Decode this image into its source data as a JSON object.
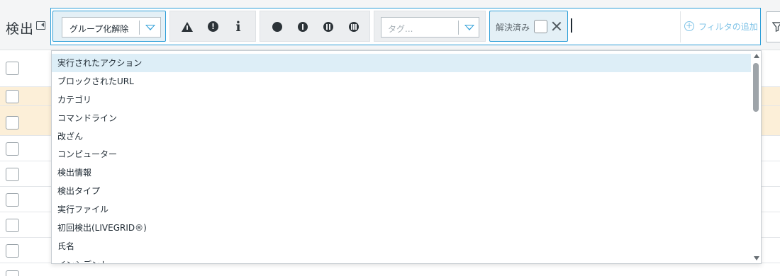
{
  "header": {
    "title": "検出"
  },
  "filters": {
    "group_select_value": "グループ化解除",
    "severity": [
      {
        "name": "warning",
        "icon": "warning-triangle-icon"
      },
      {
        "name": "error",
        "icon": "exclamation-circle-icon",
        "glyph": "!"
      },
      {
        "name": "info",
        "icon": "info-icon",
        "glyph": "i"
      }
    ],
    "status_icons": [
      "status-dot-icon",
      "status-one-bar-icon",
      "status-two-bars-icon",
      "status-three-bars-icon"
    ],
    "tag_placeholder": "タグ...",
    "resolved_label": "解決済み",
    "add_filter_icon": "+",
    "add_filter_label": "フィルタの追加"
  },
  "dropdown": {
    "options": [
      "実行されたアクション",
      "ブロックされたURL",
      "カテゴリ",
      "コマンドライン",
      "改ざん",
      "コンピューター",
      "検出情報",
      "検出タイプ",
      "実行ファイル",
      "初回検出(LIVEGRID®)",
      "氏名",
      "インシデント"
    ],
    "hovered_index": 0
  },
  "colors": {
    "accent": "#2f9fd8",
    "highlight_row": "#fcefd8",
    "hover_option": "#ddeef7"
  }
}
